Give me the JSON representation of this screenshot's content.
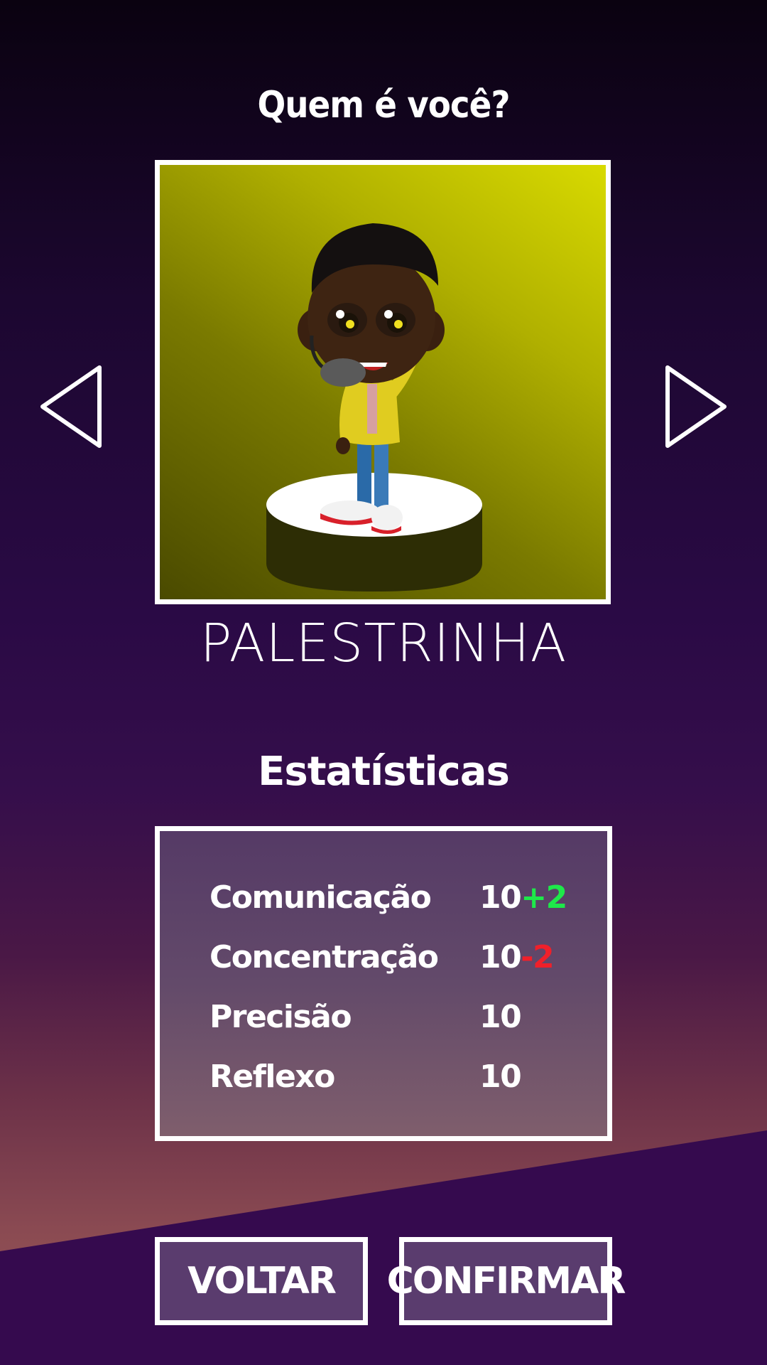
{
  "screen": {
    "title": "Quem é você?",
    "stats_title": "Estatísticas"
  },
  "character": {
    "name": "PALESTRINHA",
    "portrait_icon": "character-portrait"
  },
  "navigation": {
    "prev_icon": "triangle-left-outline",
    "next_icon": "triangle-right-outline"
  },
  "stats": [
    {
      "label": "Comunicação",
      "value": "10",
      "modifier": "+2",
      "modifier_color": "#1ee84a"
    },
    {
      "label": "Concentração",
      "value": "10",
      "modifier": "-2",
      "modifier_color": "#f0202a"
    },
    {
      "label": "Precisão",
      "value": "10",
      "modifier": ""
    },
    {
      "label": "Reflexo",
      "value": "10",
      "modifier": ""
    }
  ],
  "buttons": {
    "back_label": "VOLTAR",
    "confirm_label": "CONFIRMAR"
  },
  "colors": {
    "accent_positive": "#1ee84a",
    "accent_negative": "#f0202a",
    "button_bg": "#5a3c6e",
    "portrait_bg": "#d8da00"
  }
}
